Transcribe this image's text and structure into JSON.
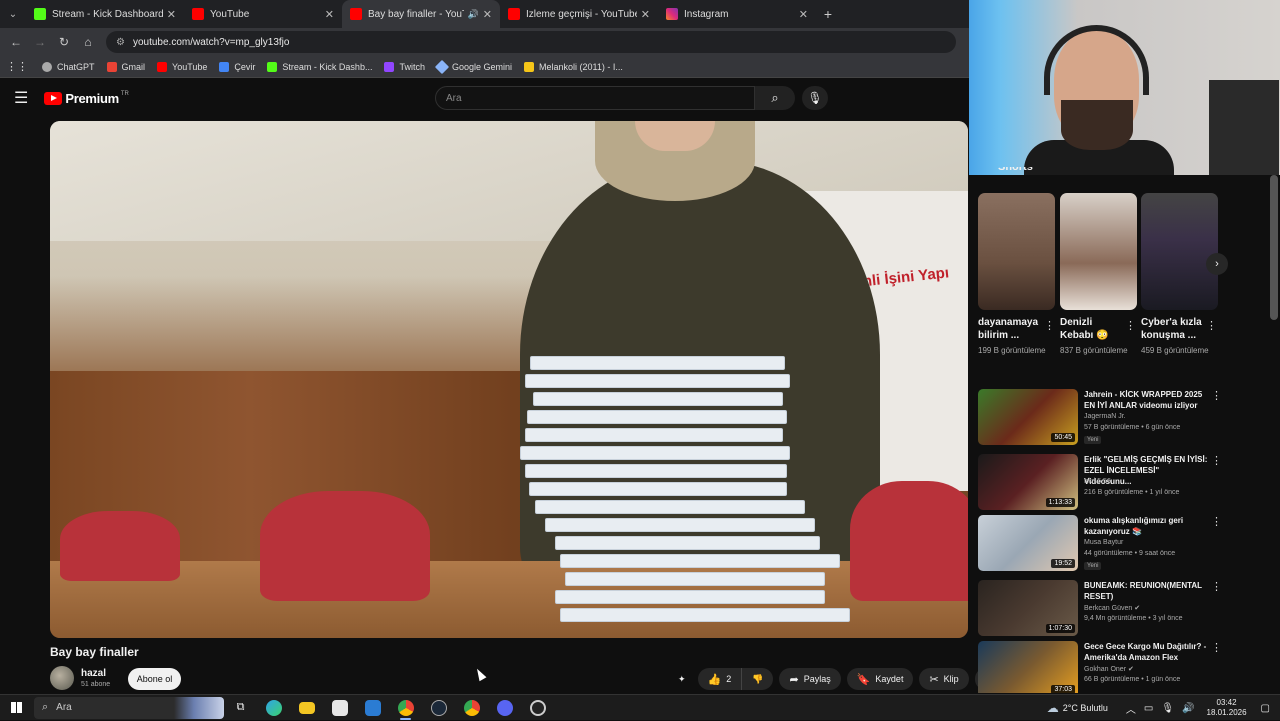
{
  "browser": {
    "tabs": [
      {
        "title": "Stream - Kick Dashboard",
        "color": "#53fc18",
        "active": false
      },
      {
        "title": "YouTube",
        "color": "#ff0000",
        "active": false
      },
      {
        "title": "Bay bay finaller - YouTube",
        "color": "#ff0000",
        "active": true
      },
      {
        "title": "İzleme geçmişi - YouTube",
        "color": "#ff0000",
        "active": false
      },
      {
        "title": "Instagram",
        "color": "#e1306c",
        "active": false
      }
    ],
    "url": "youtube.com/watch?v=mp_gly13fjo",
    "bookmarks": [
      {
        "label": "ChatGPT",
        "color": "#aaaaaa"
      },
      {
        "label": "Gmail",
        "color": "#ea4335"
      },
      {
        "label": "YouTube",
        "color": "#ff0000"
      },
      {
        "label": "Çevir",
        "color": "#4285f4"
      },
      {
        "label": "Stream - Kick Dashb...",
        "color": "#53fc18"
      },
      {
        "label": "Twitch",
        "color": "#9146ff"
      },
      {
        "label": "Google Gemini",
        "color": "#8ab4f8"
      },
      {
        "label": "Melankoli (2011) - I...",
        "color": "#f5c518"
      }
    ]
  },
  "youtube": {
    "logo_text": "Premium",
    "logo_region": "TR",
    "search_placeholder": "Ara",
    "video": {
      "title": "Bay bay finaller",
      "overlay_text": "ler,\nnemli İşini Yapı"
    },
    "channel": {
      "name": "hazal",
      "subscribers": "51 abone",
      "subscribe_label": "Abone ol"
    },
    "actions": {
      "likes": "2",
      "share": "Paylaş",
      "save": "Kaydet",
      "clip": "Klip"
    },
    "shorts_label": "Shorts",
    "shorts": [
      {
        "title": "dayanamaya bilirim ...",
        "views": "199 B görüntüleme",
        "color": "#6a5040"
      },
      {
        "title": "Denizli Kebabı 😳",
        "views": "837 B görüntüleme",
        "color": "#8a6a58"
      },
      {
        "title": "Cyber'a kızla konuşma ...",
        "views": "459 B görüntüleme",
        "color": "#3a3048"
      }
    ],
    "recommendations": [
      {
        "title": "Jahrein - KİCK WRAPPED 2025 EN İYİ ANLAR videomu izliyor",
        "channel": "JagermaN Jr.",
        "meta": "57 B görüntüleme • 6 gün önce",
        "badge": "Yeni",
        "duration": "50:45",
        "color": "#6b2a1a"
      },
      {
        "title": "Erlik \"GELMİŞ GEÇMİŞ EN İYİSİ: EZEL İNCELEMESİ\" Videosunu...",
        "channel": "Irkıl 5.56",
        "meta": "216 B görüntüleme • 1 yıl önce",
        "badge": "",
        "duration": "1:13:33",
        "color": "#5a2022"
      },
      {
        "title": "okuma alışkanlığımızı geri kazanıyoruz 📚",
        "channel": "Musa Baytur",
        "meta": "44 görüntüleme • 9 saat önce",
        "badge": "Yeni",
        "duration": "19:52",
        "color": "#9aa7b4"
      },
      {
        "title": "BUNEAMK: REUNION(MENTAL RESET)",
        "channel": "Berkcan Güven ✔",
        "meta": "9,4 Mn görüntüleme • 3 yıl önce",
        "badge": "",
        "duration": "1:07:30",
        "color": "#4a3a30"
      },
      {
        "title": "Gece Gece Kargo Mu Dağıtılır? - Amerika'da Amazon Flex",
        "channel": "Gokhan Oner ✔",
        "meta": "66 B görüntüleme • 1 gün önce",
        "badge": "",
        "duration": "37:03",
        "color": "#7a5a30"
      }
    ]
  },
  "taskbar": {
    "search_placeholder": "Ara",
    "weather": "2°C  Bulutlu",
    "time": "03:42",
    "date": "18.01.2026"
  }
}
